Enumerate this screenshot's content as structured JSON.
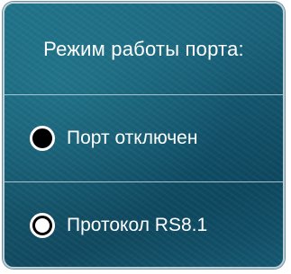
{
  "panel": {
    "title": "Режим работы порта:",
    "options": [
      {
        "label": "Порт отключен",
        "selected": false
      },
      {
        "label": "Протокол RS8.1",
        "selected": true
      }
    ]
  }
}
